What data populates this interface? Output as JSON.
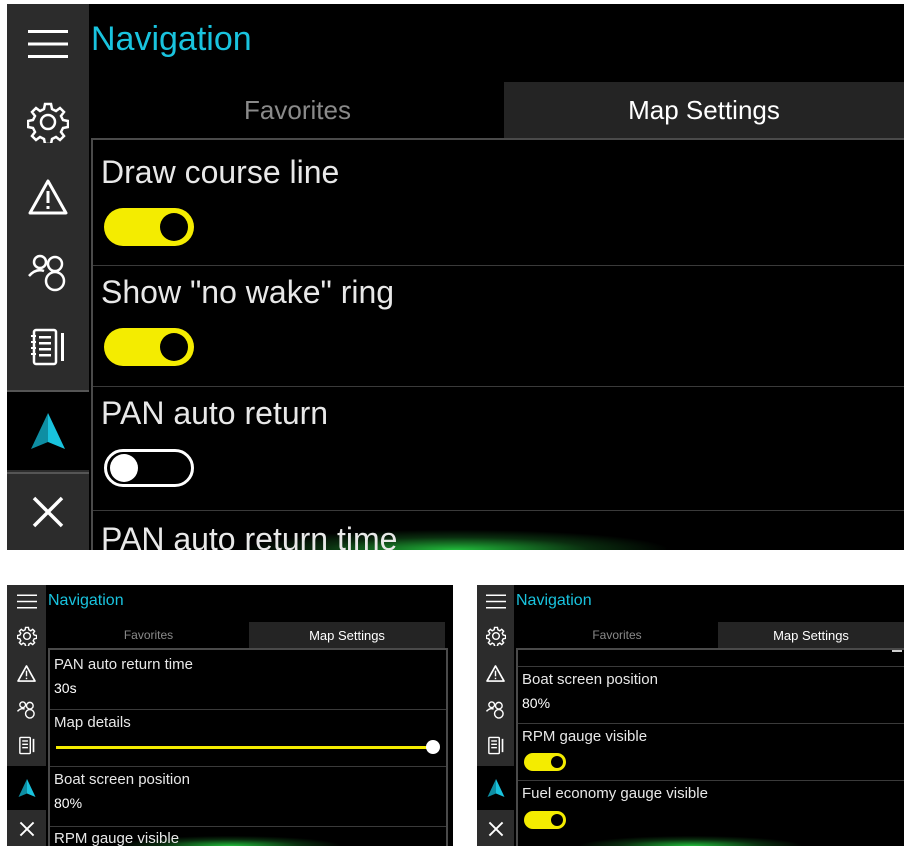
{
  "colors": {
    "accent": "#19c3de",
    "toggle_on": "#f4ec00",
    "background": "#000000",
    "sidebar": "#2c2c2c"
  },
  "screens": [
    {
      "title": "Navigation",
      "tabs": [
        "Favorites",
        "Map Settings"
      ],
      "active_tab": "Map Settings",
      "sidebar_icons": [
        "menu-icon",
        "settings-gear-icon",
        "warning-icon",
        "people-icon",
        "logbook-icon",
        "navigation-arrow-icon",
        "close-icon"
      ],
      "items": [
        {
          "label": "Draw course line",
          "type": "toggle",
          "on": true
        },
        {
          "label": "Show \"no wake\" ring",
          "type": "toggle",
          "on": true
        },
        {
          "label": "PAN auto return",
          "type": "toggle",
          "on": false
        },
        {
          "label": "PAN auto return time",
          "type": "text"
        }
      ]
    },
    {
      "title": "Navigation",
      "tabs": [
        "Favorites",
        "Map Settings"
      ],
      "active_tab": "Map Settings",
      "items": [
        {
          "label": "PAN auto return time",
          "value": "30s",
          "type": "text"
        },
        {
          "label": "Map details",
          "type": "slider",
          "level": 1.0
        },
        {
          "label": "Boat screen position",
          "value": "80%",
          "type": "text"
        },
        {
          "label": "RPM gauge visible",
          "type": "toggle"
        }
      ]
    },
    {
      "title": "Navigation",
      "tabs": [
        "Favorites",
        "Map Settings"
      ],
      "active_tab": "Map Settings",
      "items": [
        {
          "label": "Boat screen position",
          "value": "80%",
          "type": "text"
        },
        {
          "label": "RPM gauge visible",
          "type": "toggle",
          "on": true
        },
        {
          "label": "Fuel economy gauge visible",
          "type": "toggle",
          "on": true
        }
      ]
    }
  ]
}
